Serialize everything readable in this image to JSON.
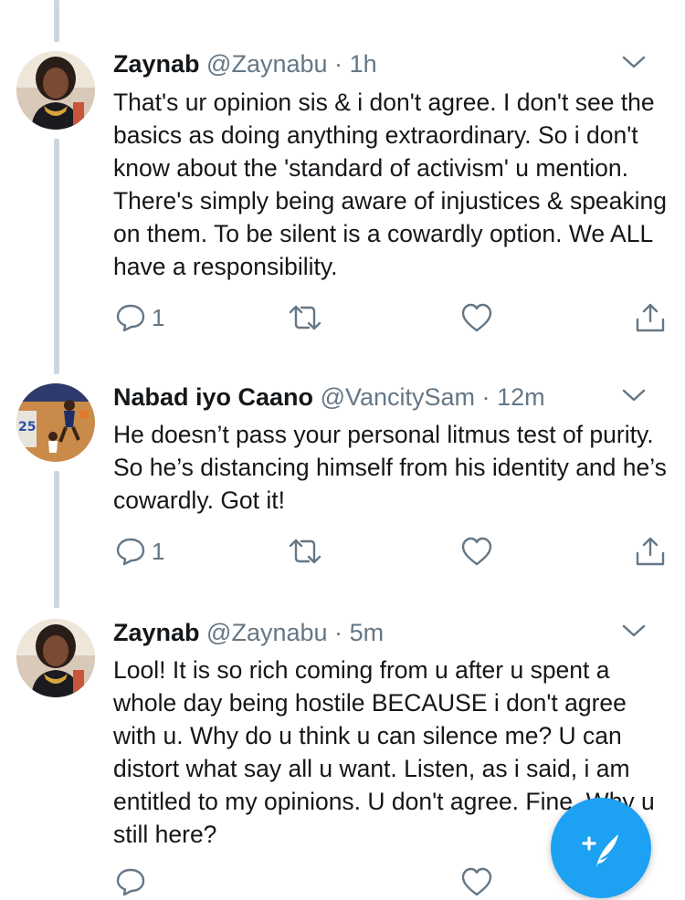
{
  "tweets": [
    {
      "name": "Zaynab",
      "handle": "@Zaynabu",
      "separator": "·",
      "time": "1h",
      "text": "That's ur opinion sis & i don't agree. I don't see the basics as doing anything extraordinary. So i don't know about the 'standard of activism' u mention. There's simply being aware of injustices & speaking on them. To be silent is a cowardly option. We ALL have a responsibility.",
      "reply_count": "1",
      "avatar_icon": "avatar-woman"
    },
    {
      "name": "Nabad iyo Caano",
      "handle": "@VancitySam",
      "separator": "·",
      "time": "12m",
      "text": "He doesn’t pass your personal litmus test of purity. So he’s distancing himself from his identity and he’s cowardly. Got it!",
      "reply_count": "1",
      "avatar_icon": "avatar-basketball"
    },
    {
      "name": "Zaynab",
      "handle": "@Zaynabu",
      "separator": "·",
      "time": "5m",
      "text": "Lool! It is so rich coming from u after u spent a whole day being hostile BECAUSE i don't agree with u. Why do u think u can silence me? U can distort what say all u want. Listen, as i said, i am entitled to my opinions. U don't agree. Fine. Why u still here?",
      "reply_count": "",
      "avatar_icon": "avatar-woman"
    }
  ],
  "compose_button": {
    "icon": "compose-tweet-icon"
  },
  "colors": {
    "accent": "#1da1f2",
    "text": "#14171a",
    "secondary": "#657786",
    "thread_line": "#ccd6dd"
  }
}
